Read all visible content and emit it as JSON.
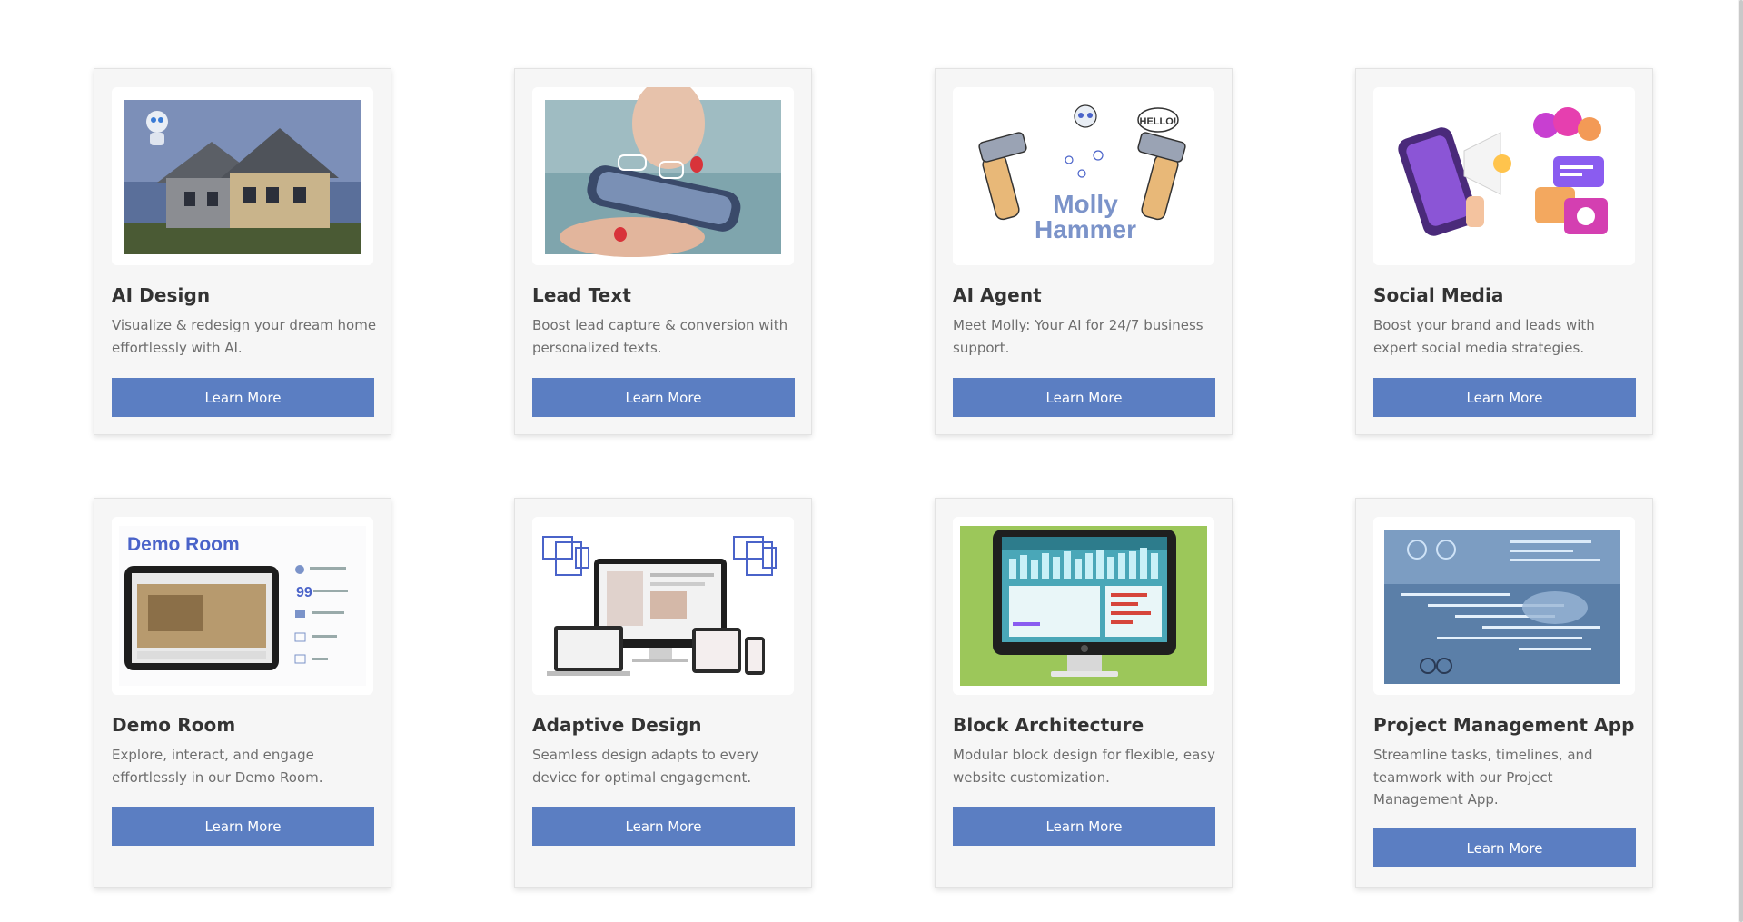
{
  "cards": [
    {
      "title": "AI Design",
      "description": "Visualize & redesign your dream home effortlessly with AI.",
      "button": "Learn More",
      "image": "ai-design-house-robot-image"
    },
    {
      "title": "Lead Text",
      "description": "Boost lead capture & conversion with personalized texts.",
      "button": "Learn More",
      "image": "lead-text-phone-hand-image"
    },
    {
      "title": "AI Agent",
      "description": "Meet Molly: Your AI for 24/7 business support.",
      "button": "Learn More",
      "image": "ai-agent-molly-hammer-image",
      "image_text": [
        "Molly",
        "Hammer",
        "HELLO!"
      ]
    },
    {
      "title": "Social Media",
      "description": "Boost your brand and leads with expert social media strategies.",
      "button": "Learn More",
      "image": "social-media-phone-megaphone-image"
    },
    {
      "title": "Demo Room",
      "description": "Explore, interact, and engage effortlessly in our Demo Room.",
      "button": "Learn More",
      "image": "demo-room-tablet-image",
      "image_text": [
        "Demo Room"
      ]
    },
    {
      "title": "Adaptive Design",
      "description": "Seamless design adapts to every device for optimal engagement.",
      "button": "Learn More",
      "image": "adaptive-design-devices-image"
    },
    {
      "title": "Block Architecture",
      "description": "Modular block design for flexible, easy website customization.",
      "button": "Learn More",
      "image": "block-architecture-monitor-image"
    },
    {
      "title": "Project Management App",
      "description": "Streamline tasks, timelines, and teamwork with our Project Management App.",
      "button": "Learn More",
      "image": "project-management-dashboard-image"
    }
  ],
  "colors": {
    "button": "#5b7ec2",
    "card_bg": "#f6f6f6",
    "title": "#333333",
    "description": "#6e6e6e"
  }
}
